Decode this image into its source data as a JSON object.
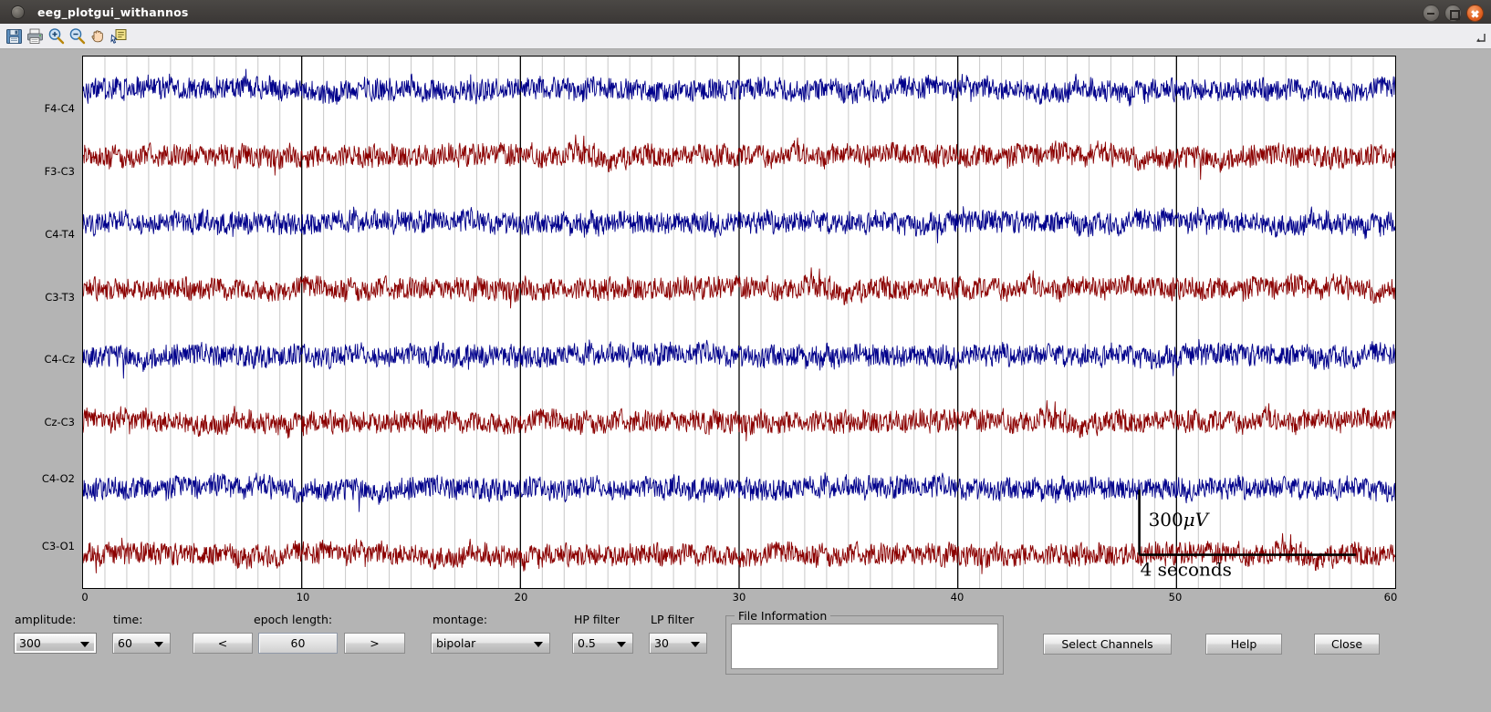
{
  "window": {
    "title": "eeg_plotgui_withannos",
    "buttons": {
      "minimize": "minimize",
      "maximize": "maximize",
      "close": "close"
    }
  },
  "toolbar": {
    "items": [
      {
        "name": "save-icon",
        "label": "Save"
      },
      {
        "name": "print-icon",
        "label": "Print"
      },
      {
        "name": "zoom-in-icon",
        "label": "Zoom In"
      },
      {
        "name": "zoom-out-icon",
        "label": "Zoom Out"
      },
      {
        "name": "pan-icon",
        "label": "Pan"
      },
      {
        "name": "annotation-icon",
        "label": "Insert Annotation"
      }
    ]
  },
  "plot": {
    "channels": [
      "F4-C4",
      "F3-C3",
      "C4-T4",
      "C3-T3",
      "C4-Cz",
      "Cz-C3",
      "C4-O2",
      "C3-O1"
    ],
    "x_ticks": [
      "0",
      "10",
      "20",
      "30",
      "40",
      "50",
      "60"
    ],
    "scale_amplitude": "300",
    "scale_amplitude_unit": "μV",
    "scale_time": "4 seconds",
    "colors": {
      "trace_blue": "#00008B",
      "trace_red": "#8B0000",
      "grid": "#c8c8c8",
      "major_grid": "#000000"
    }
  },
  "controls": {
    "amplitude": {
      "label": "amplitude:",
      "value": "300"
    },
    "time": {
      "label": "time:",
      "value": "60"
    },
    "epoch_length": {
      "label": "epoch length:",
      "value": "60",
      "prev": "<",
      "next": ">"
    },
    "montage": {
      "label": "montage:",
      "value": "bipolar"
    },
    "hp_filter": {
      "label": "HP filter",
      "value": "0.5"
    },
    "lp_filter": {
      "label": "LP filter",
      "value": "30"
    },
    "file_information": {
      "label": "File Information",
      "value": ""
    },
    "select_channels": "Select Channels",
    "help": "Help",
    "close": "Close"
  },
  "chart_data": {
    "type": "line",
    "title": "",
    "xlabel": "",
    "ylabel": "",
    "xlim": [
      0,
      60
    ],
    "x_ticks": [
      0,
      10,
      20,
      30,
      40,
      50,
      60
    ],
    "grid": true,
    "legend": "none",
    "series": [
      {
        "name": "F4-C4",
        "color": "#00008B",
        "baseline": 1,
        "amplitude_uv": 300
      },
      {
        "name": "F3-C3",
        "color": "#8B0000",
        "baseline": 2,
        "amplitude_uv": 300
      },
      {
        "name": "C4-T4",
        "color": "#00008B",
        "baseline": 3,
        "amplitude_uv": 300
      },
      {
        "name": "C3-T3",
        "color": "#8B0000",
        "baseline": 4,
        "amplitude_uv": 300
      },
      {
        "name": "C4-Cz",
        "color": "#00008B",
        "baseline": 5,
        "amplitude_uv": 300
      },
      {
        "name": "Cz-C3",
        "color": "#8B0000",
        "baseline": 6,
        "amplitude_uv": 300
      },
      {
        "name": "C4-O2",
        "color": "#00008B",
        "baseline": 7,
        "amplitude_uv": 300
      },
      {
        "name": "C3-O1",
        "color": "#8B0000",
        "baseline": 8,
        "amplitude_uv": 300
      }
    ]
  }
}
